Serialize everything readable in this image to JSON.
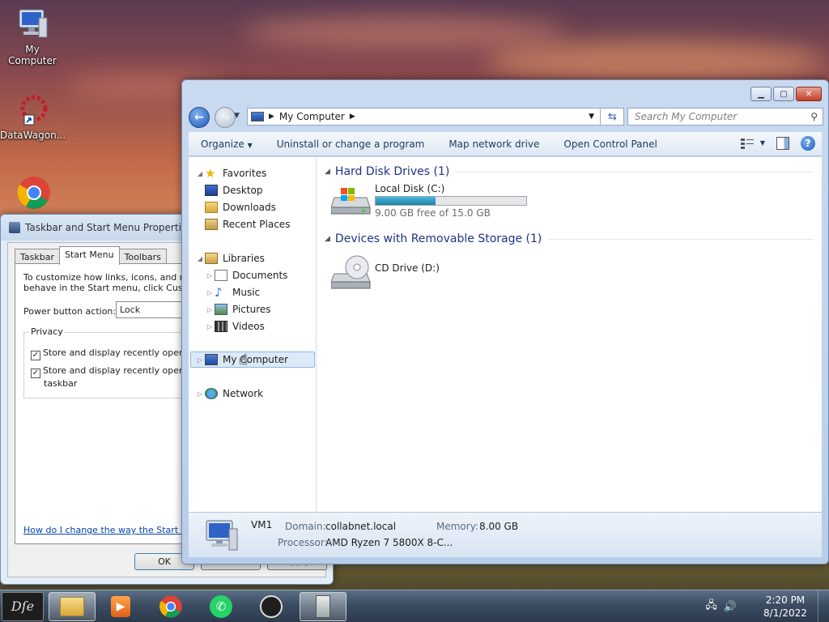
{
  "desktop": {
    "icons": [
      {
        "label": "My Computer",
        "icon": "computer-icon"
      },
      {
        "label": "DataWagon...",
        "icon": "datawagon-shortcut-icon"
      },
      {
        "label": "",
        "icon": "chrome-shortcut-icon"
      }
    ]
  },
  "dialog": {
    "title": "Taskbar and Start Menu Properties",
    "tabs": [
      "Taskbar",
      "Start Menu",
      "Toolbars"
    ],
    "active_tab": "Start Menu",
    "description_line1": "To customize how links, icons, and menus",
    "description_line2": "behave in the Start menu, click Customiz",
    "power_label": "Power button action:",
    "power_value": "Lock",
    "privacy_label": "Privacy",
    "check1": "Store and display recently opened p",
    "check2_line1": "Store and display recently opened i",
    "check2_line2": "taskbar",
    "help_link": "How do I change the way the Start menu",
    "ok": "OK",
    "cancel": "Cancel",
    "apply": "Apply"
  },
  "explorer": {
    "address": "My Computer",
    "search_placeholder": "Search My Computer",
    "commands": [
      "Organize",
      "Uninstall or change a program",
      "Map network drive",
      "Open Control Panel"
    ],
    "nav": {
      "favorites": "Favorites",
      "desktop": "Desktop",
      "downloads": "Downloads",
      "recent": "Recent Places",
      "libraries": "Libraries",
      "documents": "Documents",
      "music": "Music",
      "pictures": "Pictures",
      "videos": "Videos",
      "computer": "My Computer",
      "network": "Network"
    },
    "groups": {
      "hdd": "Hard Disk Drives (1)",
      "removable": "Devices with Removable Storage (1)"
    },
    "drive_c": {
      "name": "Local Disk (C:)",
      "free_text": "9.00 GB free of 15.0 GB",
      "used_fraction": 0.4
    },
    "drive_d": {
      "name": "CD Drive (D:)"
    },
    "status": {
      "name": "VM1",
      "domain_label": "Domain:",
      "domain": "collabnet.local",
      "memory_label": "Memory:",
      "memory": "8.00 GB",
      "processor_label": "Processor:",
      "processor": "AMD Ryzen 7 5800X 8-C..."
    }
  },
  "taskbar": {
    "clock_time": "2:20 PM",
    "clock_date": "8/1/2022"
  }
}
